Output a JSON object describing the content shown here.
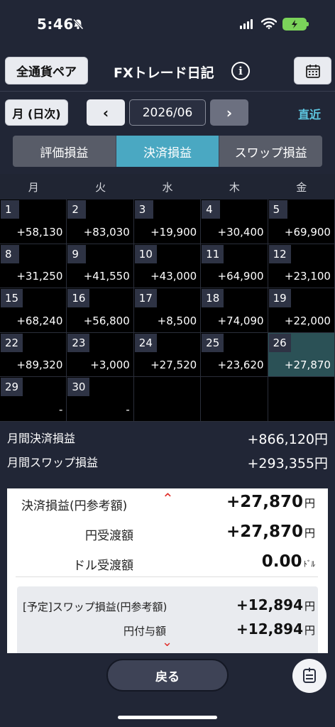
{
  "status": {
    "time": "5:46"
  },
  "header": {
    "currency_button": "全通貨ペア",
    "title": "FXトレード日記",
    "info_icon": "i"
  },
  "nav": {
    "period_button": "月 (日次)",
    "prev": "‹",
    "next": "›",
    "current": "2026/06",
    "recent": "直近"
  },
  "tabs": [
    {
      "label": "評価損益",
      "active": false
    },
    {
      "label": "決済損益",
      "active": true
    },
    {
      "label": "スワップ損益",
      "active": false
    }
  ],
  "calendar": {
    "weekdays": [
      "月",
      "火",
      "水",
      "木",
      "金"
    ],
    "cells": [
      {
        "day": "1",
        "value": "+58,130"
      },
      {
        "day": "2",
        "value": "+83,030"
      },
      {
        "day": "3",
        "value": "+19,900"
      },
      {
        "day": "4",
        "value": "+30,400"
      },
      {
        "day": "5",
        "value": "+69,900"
      },
      {
        "day": "8",
        "value": "+31,250"
      },
      {
        "day": "9",
        "value": "+41,550"
      },
      {
        "day": "10",
        "value": "+43,000"
      },
      {
        "day": "11",
        "value": "+64,900"
      },
      {
        "day": "12",
        "value": "+23,100"
      },
      {
        "day": "15",
        "value": "+68,240"
      },
      {
        "day": "16",
        "value": "+56,800"
      },
      {
        "day": "17",
        "value": "+8,500"
      },
      {
        "day": "18",
        "value": "+74,090"
      },
      {
        "day": "19",
        "value": "+22,000"
      },
      {
        "day": "22",
        "value": "+89,320"
      },
      {
        "day": "23",
        "value": "+3,000"
      },
      {
        "day": "24",
        "value": "+27,520"
      },
      {
        "day": "25",
        "value": "+23,620"
      },
      {
        "day": "26",
        "value": "+27,870",
        "selected": true
      },
      {
        "day": "29",
        "value": "-"
      },
      {
        "day": "30",
        "value": "-"
      },
      {
        "day": "",
        "value": ""
      },
      {
        "day": "",
        "value": ""
      },
      {
        "day": "",
        "value": ""
      }
    ]
  },
  "totals": {
    "settled_label": "月間決済損益",
    "settled_value": "+866,120円",
    "swap_label": "月間スワップ損益",
    "swap_value": "+293,355円"
  },
  "detail": {
    "settled_label": "決済損益(円参考額)",
    "settled_value": "+27,870",
    "settled_unit": "円",
    "yen_label": "円受渡額",
    "yen_value": "+27,870",
    "yen_unit": "円",
    "usd_label": "ドル受渡額",
    "usd_value": "0.00",
    "usd_unit": "ﾄﾞﾙ",
    "swap_label": "[予定]スワップ損益(円参考額)",
    "swap_value": "+12,894",
    "swap_unit": "円",
    "yen_grant_label": "円付与額",
    "yen_grant_value": "+12,894",
    "yen_grant_unit": "円"
  },
  "footer": {
    "back": "戻る"
  }
}
